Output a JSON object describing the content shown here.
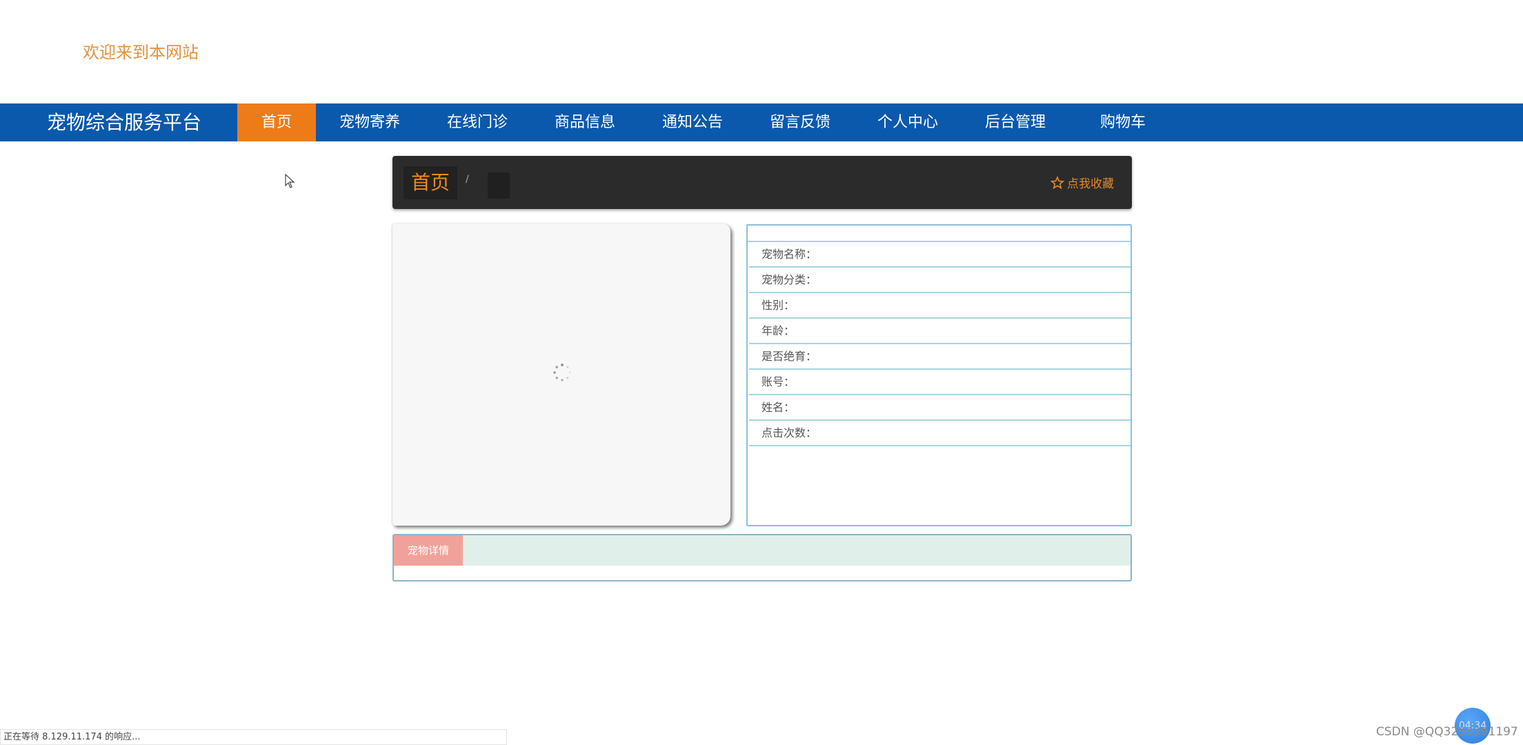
{
  "header": {
    "welcome": "欢迎来到本网站"
  },
  "navbar": {
    "brand": "宠物综合服务平台",
    "items": [
      {
        "label": "首页",
        "active": true
      },
      {
        "label": "宠物寄养",
        "active": false
      },
      {
        "label": "在线门诊",
        "active": false
      },
      {
        "label": "商品信息",
        "active": false
      },
      {
        "label": "通知公告",
        "active": false
      },
      {
        "label": "留言反馈",
        "active": false
      },
      {
        "label": "个人中心",
        "active": false
      },
      {
        "label": "后台管理",
        "active": false
      },
      {
        "label": "购物车",
        "active": false
      }
    ]
  },
  "breadcrumb": {
    "home": "首页",
    "separator": "/",
    "current": "",
    "favorite_label": "点我收藏",
    "favorite_icon": "star-outline-icon"
  },
  "image_panel": {
    "state": "loading",
    "icon": "loading-spinner-icon"
  },
  "info_panel": {
    "header": "",
    "fields": [
      {
        "label": "宠物名称：",
        "value": ""
      },
      {
        "label": "宠物分类：",
        "value": ""
      },
      {
        "label": "性别：",
        "value": ""
      },
      {
        "label": "年龄：",
        "value": ""
      },
      {
        "label": "是否绝育：",
        "value": ""
      },
      {
        "label": "账号：",
        "value": ""
      },
      {
        "label": "姓名：",
        "value": ""
      },
      {
        "label": "点击次数：",
        "value": ""
      }
    ]
  },
  "detail_panel": {
    "tab_label": "宠物详情",
    "content": ""
  },
  "status_bar": {
    "text": "正在等待 8.129.11.174 的响应..."
  },
  "overlay": {
    "clock": "04:34",
    "watermark": "CSDN @QQ3295391197"
  },
  "colors": {
    "nav_bg": "#0a59ac",
    "nav_active": "#ee7b19",
    "welcome_text": "#e3933c",
    "breadcrumb_bg": "#2b2b2b",
    "breadcrumb_accent": "#f08a1e",
    "info_border": "#8cbfdc",
    "detail_tab": "#f0a29a",
    "detail_tab_strip": "#e1efea"
  }
}
